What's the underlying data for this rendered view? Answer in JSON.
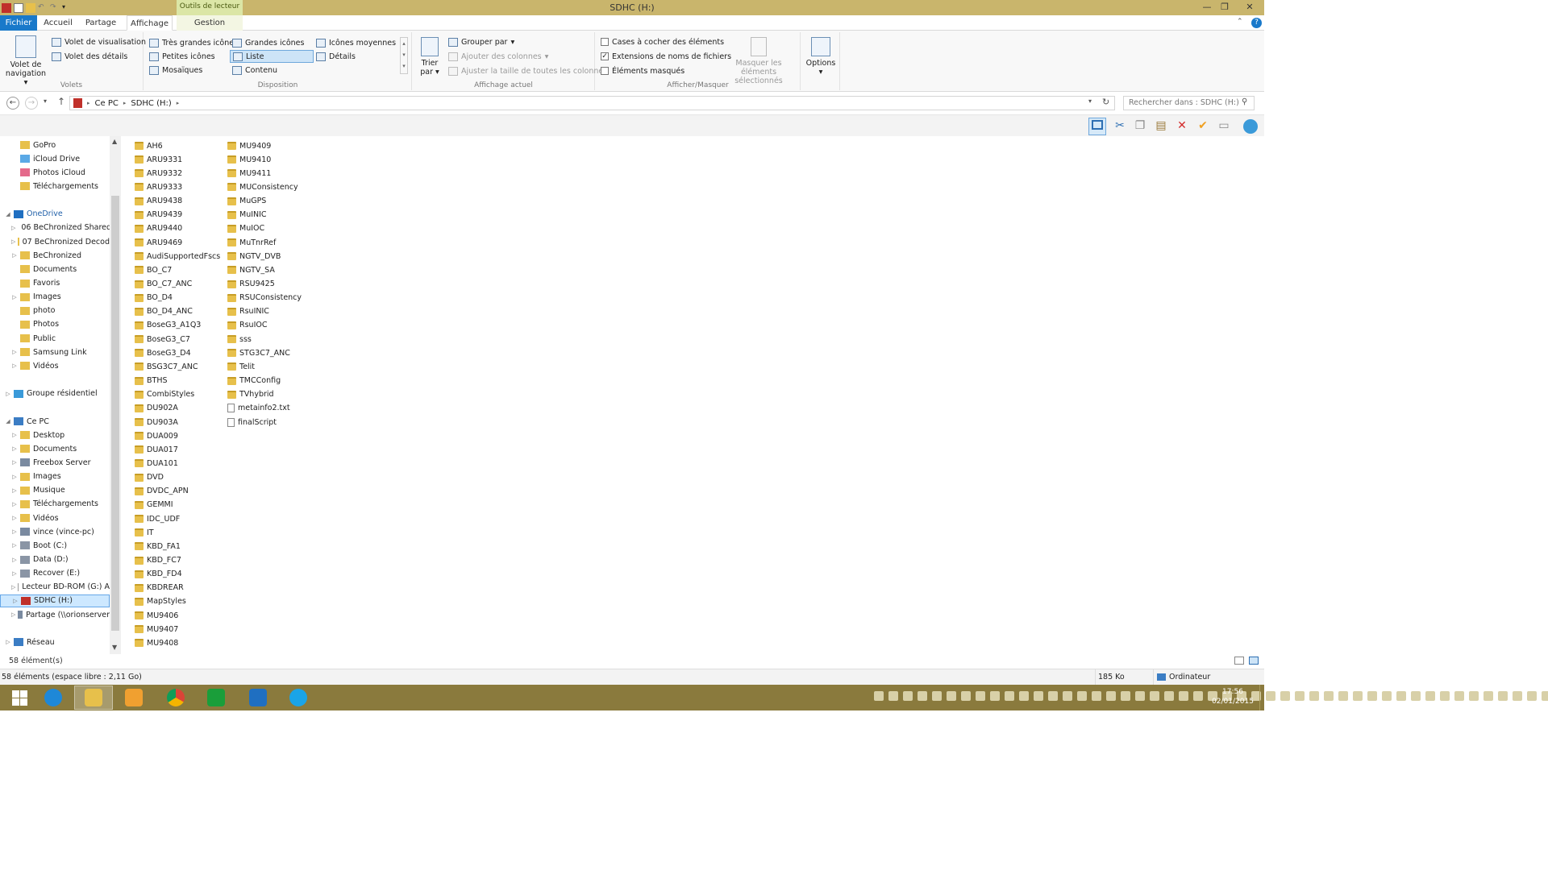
{
  "window": {
    "title": "SDHC (H:)",
    "tools_tab": "Outils de lecteur",
    "quick_access_icon": "sd-card-icon"
  },
  "tabs": [
    "Fichier",
    "Accueil",
    "Partage",
    "Affichage",
    "Gestion"
  ],
  "ribbon": {
    "panes": {
      "nav_pane_line1": "Volet de",
      "nav_pane_line2": "navigation",
      "preview_pane": "Volet de visualisation",
      "details_pane": "Volet des détails",
      "label": "Volets"
    },
    "layout": {
      "extra_large": "Très grandes icônes",
      "large": "Grandes icônes",
      "medium": "Icônes moyennes",
      "small": "Petites icônes",
      "list": "Liste",
      "details": "Détails",
      "tiles": "Mosaïques",
      "content": "Contenu",
      "label": "Disposition"
    },
    "current_view": {
      "sort_line1": "Trier",
      "sort_line2": "par",
      "group_by": "Grouper par",
      "add_columns": "Ajouter des colonnes",
      "size_columns": "Ajuster la taille de toutes les colonnes",
      "label": "Affichage actuel"
    },
    "show_hide": {
      "item_checkboxes": "Cases à cocher des éléments",
      "file_extensions": "Extensions de noms de fichiers",
      "hidden_items": "Éléments masqués",
      "hide_selected_line1": "Masquer les éléments",
      "hide_selected_line2": "sélectionnés",
      "label": "Afficher/Masquer",
      "item_checkboxes_checked": false,
      "file_extensions_checked": true,
      "hidden_items_checked": false
    },
    "options": "Options"
  },
  "address": {
    "crumbs": [
      "Ce PC",
      "SDHC (H:)"
    ],
    "search_placeholder": "Rechercher dans : SDHC (H:)"
  },
  "nav_items": [
    {
      "label": "GoPro",
      "icon": "folder-icon"
    },
    {
      "label": "iCloud Drive",
      "icon": "icloud-icon"
    },
    {
      "label": "Photos iCloud",
      "icon": "photos-icon"
    },
    {
      "label": "Téléchargements",
      "icon": "folder-icon"
    },
    {
      "label": "",
      "icon": ""
    },
    {
      "label": "OneDrive",
      "icon": "onedrive-icon"
    },
    {
      "label": "06 BeChronized Shared",
      "icon": "folder-icon"
    },
    {
      "label": "07 BeChronized Decod",
      "icon": "folder-icon"
    },
    {
      "label": "BeChronized",
      "icon": "folder-icon"
    },
    {
      "label": "Documents",
      "icon": "folder-icon"
    },
    {
      "label": "Favoris",
      "icon": "folder-icon"
    },
    {
      "label": "Images",
      "icon": "folder-icon"
    },
    {
      "label": "photo",
      "icon": "folder-icon"
    },
    {
      "label": "Photos",
      "icon": "folder-icon"
    },
    {
      "label": "Public",
      "icon": "folder-icon"
    },
    {
      "label": "Samsung Link",
      "icon": "folder-icon"
    },
    {
      "label": "Vidéos",
      "icon": "folder-icon"
    },
    {
      "label": "",
      "icon": ""
    },
    {
      "label": "Groupe résidentiel",
      "icon": "homegroup-icon"
    },
    {
      "label": "",
      "icon": ""
    },
    {
      "label": "Ce PC",
      "icon": "computer-icon"
    },
    {
      "label": "Desktop",
      "icon": "folder-icon"
    },
    {
      "label": "Documents",
      "icon": "folder-icon"
    },
    {
      "label": "Freebox Server",
      "icon": "network-drive-icon"
    },
    {
      "label": "Images",
      "icon": "folder-icon"
    },
    {
      "label": "Musique",
      "icon": "folder-icon"
    },
    {
      "label": "Téléchargements",
      "icon": "folder-icon"
    },
    {
      "label": "Vidéos",
      "icon": "folder-icon"
    },
    {
      "label": "vince (vince-pc)",
      "icon": "network-drive-icon"
    },
    {
      "label": "Boot (C:)",
      "icon": "drive-icon"
    },
    {
      "label": "Data (D:)",
      "icon": "drive-icon"
    },
    {
      "label": "Recover (E:)",
      "icon": "drive-icon"
    },
    {
      "label": "Lecteur BD-ROM (G:) A",
      "icon": "disc-icon"
    },
    {
      "label": "SDHC (H:)",
      "icon": "sd-card-icon"
    },
    {
      "label": "Partage (\\\\orionserver",
      "icon": "network-drive-icon"
    },
    {
      "label": "",
      "icon": ""
    },
    {
      "label": "Réseau",
      "icon": "network-icon"
    }
  ],
  "files_col1": [
    "AH6",
    "ARU9331",
    "ARU9332",
    "ARU9333",
    "ARU9438",
    "ARU9439",
    "ARU9440",
    "ARU9469",
    "AudiSupportedFscs",
    "BO_C7",
    "BO_C7_ANC",
    "BO_D4",
    "BO_D4_ANC",
    "BoseG3_A1Q3",
    "BoseG3_C7",
    "BoseG3_D4",
    "BSG3C7_ANC",
    "BTHS",
    "CombiStyles",
    "DU902A",
    "DU903A",
    "DUA009",
    "DUA017",
    "DUA101",
    "DVD",
    "DVDC_APN",
    "GEMMI",
    "IDC_UDF",
    "IT",
    "KBD_FA1",
    "KBD_FC7",
    "KBD_FD4",
    "KBDREAR",
    "MapStyles",
    "MU9406",
    "MU9407",
    "MU9408"
  ],
  "files_col2": [
    "MU9409",
    "MU9410",
    "MU9411",
    "MUConsistency",
    "MuGPS",
    "MuINIC",
    "MuIOC",
    "MuTnrRef",
    "NGTV_DVB",
    "NGTV_SA",
    "RSU9425",
    "RSUConsistency",
    "RsuINIC",
    "RsuIOC",
    "sss",
    "STG3C7_ANC",
    "Telit",
    "TMCConfig",
    "TVhybrid",
    "metainfo2.txt",
    "finalScript"
  ],
  "status": {
    "count": "58 élément(s)",
    "free_space": "58 éléments (espace libre : 2,11 Go)",
    "size": "185 Ko",
    "location": "Ordinateur"
  },
  "taskbar": {
    "apps": [
      "windows-start-icon",
      "internet-explorer-icon",
      "file-explorer-icon",
      "media-player-icon",
      "chrome-icon",
      "store-icon",
      "outlook-icon",
      "skype-icon"
    ],
    "time": "17:56",
    "date": "02/01/2015"
  },
  "colors": {
    "title_bar": "#c9b56c",
    "file_tab": "#1979ca",
    "taskbar": "#8a7a3d",
    "folder": "#e7c04b"
  }
}
